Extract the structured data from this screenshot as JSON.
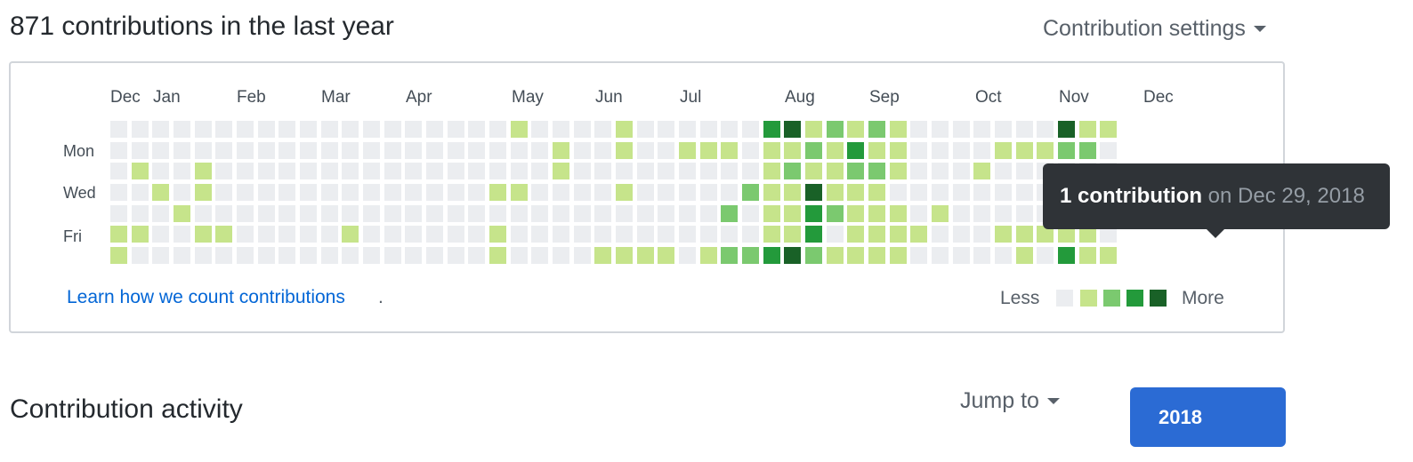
{
  "header": {
    "title": "871 contributions in the last year",
    "settings_label": "Contribution settings",
    "settings_icon": "caret-down-icon"
  },
  "calendar": {
    "months": [
      "Dec",
      "Jan",
      "Feb",
      "Mar",
      "Apr",
      "May",
      "Jun",
      "Jul",
      "Aug",
      "Sep",
      "Oct",
      "Nov",
      "Dec"
    ],
    "day_labels": [
      "Mon",
      "Wed",
      "Fri"
    ],
    "levels": [
      "#ebedf0",
      "#c6e48b",
      "#7bc96f",
      "#239a3b",
      "#196127"
    ],
    "weeks": [
      [
        0,
        0,
        0,
        0,
        0,
        1,
        1
      ],
      [
        0,
        0,
        1,
        0,
        0,
        1,
        0
      ],
      [
        0,
        0,
        0,
        1,
        0,
        0,
        0
      ],
      [
        0,
        0,
        0,
        0,
        1,
        0,
        0
      ],
      [
        0,
        0,
        1,
        1,
        0,
        1,
        0
      ],
      [
        0,
        0,
        0,
        0,
        0,
        1,
        0
      ],
      [
        0,
        0,
        0,
        0,
        0,
        0,
        0
      ],
      [
        0,
        0,
        0,
        0,
        0,
        0,
        0
      ],
      [
        0,
        0,
        0,
        0,
        0,
        0,
        0
      ],
      [
        0,
        0,
        0,
        0,
        0,
        0,
        0
      ],
      [
        0,
        0,
        0,
        0,
        0,
        0,
        0
      ],
      [
        0,
        0,
        0,
        0,
        0,
        1,
        0
      ],
      [
        0,
        0,
        0,
        0,
        0,
        0,
        0
      ],
      [
        0,
        0,
        0,
        0,
        0,
        0,
        0
      ],
      [
        0,
        0,
        0,
        0,
        0,
        0,
        0
      ],
      [
        0,
        0,
        0,
        0,
        0,
        0,
        0
      ],
      [
        0,
        0,
        0,
        0,
        0,
        0,
        0
      ],
      [
        0,
        0,
        0,
        0,
        0,
        0,
        0
      ],
      [
        0,
        0,
        0,
        1,
        0,
        1,
        1
      ],
      [
        1,
        0,
        0,
        1,
        0,
        0,
        0
      ],
      [
        0,
        0,
        0,
        0,
        0,
        0,
        0
      ],
      [
        0,
        1,
        1,
        0,
        0,
        0,
        0
      ],
      [
        0,
        0,
        0,
        0,
        0,
        0,
        0
      ],
      [
        0,
        0,
        0,
        0,
        0,
        0,
        1
      ],
      [
        1,
        1,
        0,
        1,
        0,
        0,
        1
      ],
      [
        0,
        0,
        0,
        0,
        0,
        0,
        1
      ],
      [
        0,
        0,
        0,
        0,
        0,
        0,
        1
      ],
      [
        0,
        1,
        0,
        0,
        0,
        0,
        0
      ],
      [
        0,
        1,
        0,
        0,
        0,
        0,
        1
      ],
      [
        0,
        1,
        0,
        0,
        2,
        0,
        2
      ],
      [
        0,
        0,
        0,
        2,
        0,
        0,
        2
      ],
      [
        3,
        1,
        1,
        1,
        1,
        1,
        3
      ],
      [
        4,
        1,
        2,
        1,
        1,
        1,
        4
      ],
      [
        1,
        2,
        1,
        4,
        3,
        3,
        2
      ],
      [
        2,
        1,
        1,
        1,
        2,
        0,
        1
      ],
      [
        1,
        3,
        2,
        1,
        1,
        1,
        1
      ],
      [
        2,
        1,
        2,
        1,
        1,
        1,
        1
      ],
      [
        1,
        1,
        1,
        0,
        1,
        1,
        1
      ],
      [
        0,
        0,
        0,
        0,
        0,
        1,
        0
      ],
      [
        0,
        0,
        0,
        0,
        1,
        0,
        0
      ],
      [
        0,
        0,
        0,
        0,
        0,
        0,
        0
      ],
      [
        0,
        0,
        1,
        0,
        0,
        0,
        0
      ],
      [
        0,
        1,
        0,
        0,
        0,
        1,
        0
      ],
      [
        0,
        1,
        0,
        0,
        0,
        1,
        1
      ],
      [
        0,
        1,
        0,
        0,
        0,
        1,
        0
      ],
      [
        4,
        2,
        0,
        0,
        0,
        1,
        3
      ],
      [
        1,
        2,
        0,
        0,
        0,
        1,
        1
      ],
      [
        1,
        0,
        0,
        0,
        0,
        0,
        1
      ]
    ],
    "learn_link": "Learn how we count contributions",
    "learn_suffix": ".",
    "legend_less": "Less",
    "legend_more": "More"
  },
  "tooltip": {
    "count": "1 contribution",
    "date_text": " on Dec 29, 2018"
  },
  "activity": {
    "title": "Contribution activity",
    "jump_label": "Jump to",
    "jump_icon": "caret-down-icon",
    "year_button": "2018"
  }
}
